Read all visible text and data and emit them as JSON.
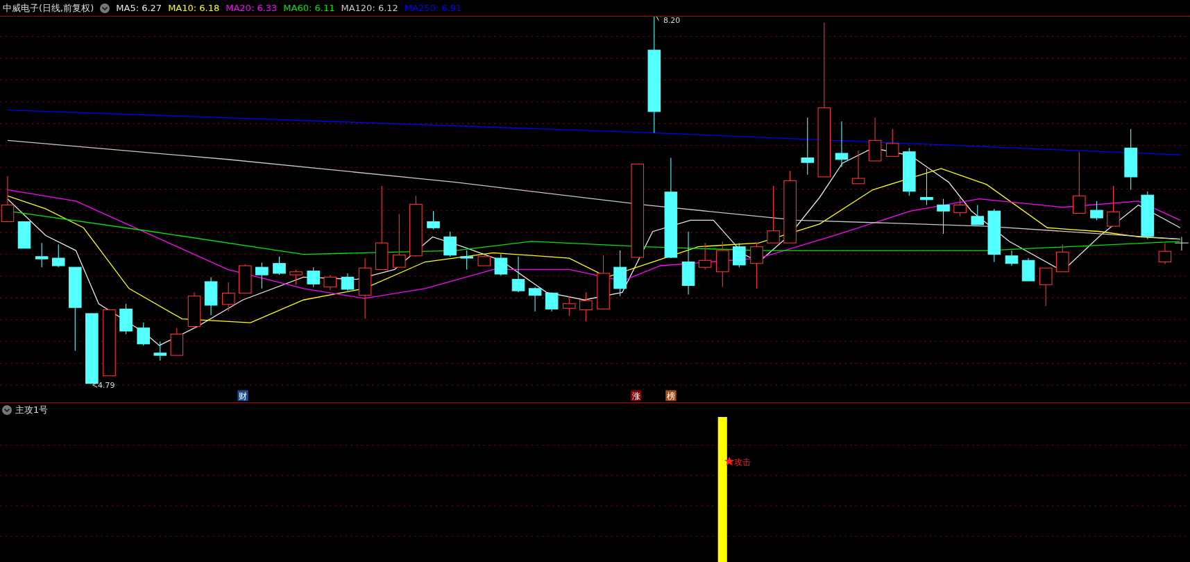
{
  "header": {
    "title": "中威电子(日线,前复权)",
    "indicators": [
      {
        "label": "MA5: 6.27",
        "color": "#e6e6e6"
      },
      {
        "label": "MA10: 6.18",
        "color": "#ffff00"
      },
      {
        "label": "MA20: 6.33",
        "color": "#ff00ff"
      },
      {
        "label": "MA60: 6.11",
        "color": "#00e600"
      },
      {
        "label": "MA120: 6.12",
        "color": "#c8c8c8"
      },
      {
        "label": "MA250: 6.91",
        "color": "#0000ff"
      }
    ]
  },
  "price_chart": {
    "high_label": "8.20",
    "low_label": "4.79",
    "events": [
      {
        "label": "财",
        "color": "#1f4e8c"
      },
      {
        "label": "涨",
        "color": "#8b0000"
      },
      {
        "label": "榜",
        "color": "#a0521a"
      }
    ]
  },
  "sub_panel": {
    "title": "主攻1号",
    "signal_label": "攻击"
  }
}
